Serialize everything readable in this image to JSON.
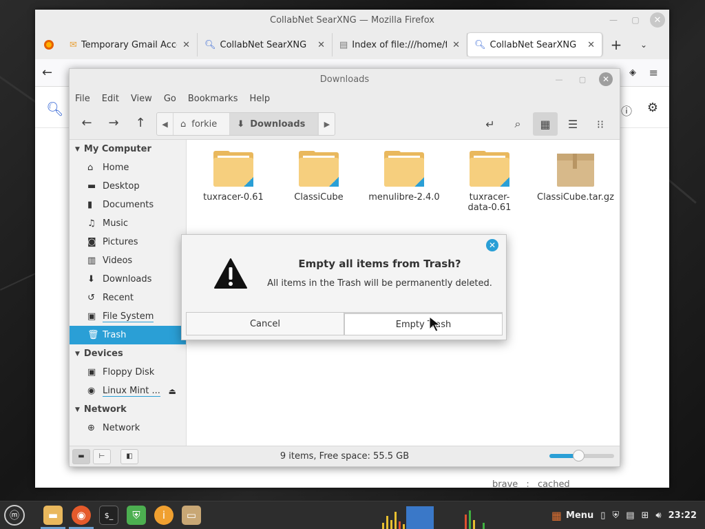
{
  "firefox": {
    "title": "CollabNet SearXNG — Mozilla Firefox",
    "tabs": [
      {
        "label": "Temporary Gmail Account",
        "icon": "mail-icon"
      },
      {
        "label": "CollabNet SearXNG",
        "icon": "search-icon"
      },
      {
        "label": "Index of file:///home/forkie",
        "icon": "file-icon"
      },
      {
        "label": "CollabNet SearXNG",
        "icon": "search-icon",
        "active": true
      }
    ],
    "footer_links": [
      "brave",
      ":",
      "cached"
    ]
  },
  "nemo": {
    "title": "Downloads",
    "menu": [
      "File",
      "Edit",
      "View",
      "Go",
      "Bookmarks",
      "Help"
    ],
    "path": [
      {
        "label": "forkie",
        "icon": "home-icon"
      },
      {
        "label": "Downloads",
        "icon": "download-icon"
      }
    ],
    "sidebar": {
      "sections": [
        {
          "header": "My Computer",
          "items": [
            "Home",
            "Desktop",
            "Documents",
            "Music",
            "Pictures",
            "Videos",
            "Downloads",
            "Recent",
            "File System",
            "Trash"
          ]
        },
        {
          "header": "Devices",
          "items": [
            "Floppy Disk",
            "Linux Mint ..."
          ]
        },
        {
          "header": "Network",
          "items": [
            "Network"
          ]
        }
      ],
      "selected": "Trash"
    },
    "files": [
      {
        "name": "tuxracer-0.61",
        "type": "folder"
      },
      {
        "name": "ClassiCube",
        "type": "folder"
      },
      {
        "name": "menulibre-2.4.0",
        "type": "folder"
      },
      {
        "name": "tuxracer-data-0.61",
        "type": "folder"
      },
      {
        "name": "ClassiCube.tar.gz",
        "type": "archive"
      }
    ],
    "status": "9 items, Free space: 55.5 GB",
    "zoom_level": 0.45
  },
  "dialog": {
    "title": "Empty all items from Trash?",
    "message": "All items in the Trash will be permanently deleted.",
    "cancel": "Cancel",
    "confirm": "Empty Trash"
  },
  "taskbar": {
    "menu_label": "Menu",
    "clock": "23:22"
  },
  "colors": {
    "accent": "#2a9fd6",
    "folder": "#f6cf7e",
    "taskbar": "#2d2d2d"
  }
}
